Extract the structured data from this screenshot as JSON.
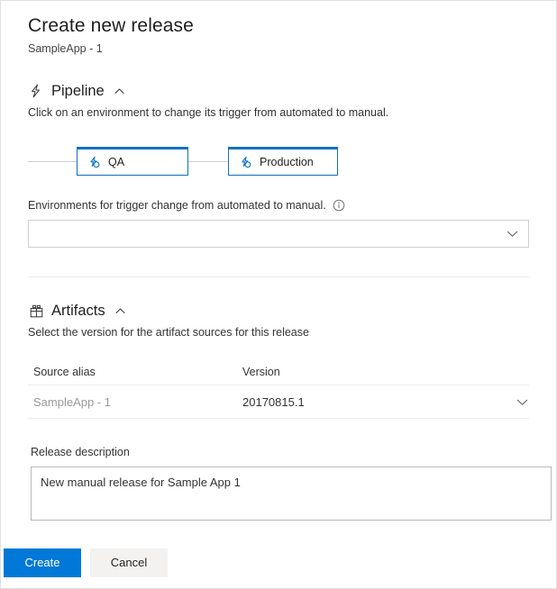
{
  "dialog": {
    "title": "Create new release",
    "subtitle": "SampleApp - 1"
  },
  "pipeline": {
    "icon": "lightning-bolt-icon",
    "title": "Pipeline",
    "collapse_icon": "chevron-up-icon",
    "description": "Click on an environment to change its trigger from automated to manual.",
    "environments": [
      {
        "name": "QA",
        "icon": "environment-trigger-icon"
      },
      {
        "name": "Production",
        "icon": "environment-trigger-icon"
      }
    ],
    "trigger_field": {
      "label": "Environments for trigger change from automated to manual.",
      "info_icon": "info-circle-icon",
      "value": "",
      "placeholder": "",
      "chevron_icon": "chevron-down-icon"
    }
  },
  "artifacts": {
    "icon": "gift-box-icon",
    "title": "Artifacts",
    "collapse_icon": "chevron-up-icon",
    "description": "Select the version for the artifact sources for this release",
    "columns": [
      "Source alias",
      "Version"
    ],
    "rows": [
      {
        "source_alias": "SampleApp - 1",
        "version": "20170815.1",
        "chevron_icon": "chevron-down-icon"
      }
    ]
  },
  "release_description": {
    "label": "Release description",
    "value": "New manual release for Sample App 1",
    "placeholder": ""
  },
  "actions": {
    "create_label": "Create",
    "cancel_label": "Cancel"
  },
  "colors": {
    "primary_blue": "#0078d7",
    "env_border_blue": "#0e70c0",
    "secondary_gray": "#f3f2f1",
    "divider": "#eaeaea"
  }
}
